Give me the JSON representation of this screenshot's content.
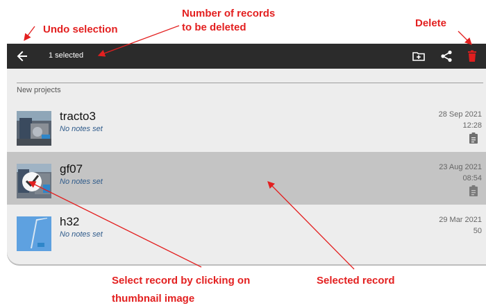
{
  "annotations": {
    "undo_selection": "Undo selection",
    "number_of_records_line1": "Number of records",
    "number_of_records_line2": "to be deleted",
    "delete": "Delete",
    "select_record_line1": "Select record by clicking on",
    "select_record_line2": "thumbnail image",
    "selected_record": "Selected record"
  },
  "appbar": {
    "back_icon": "arrow-left-icon",
    "selection_text": "1 selected",
    "actions": [
      {
        "name": "move-to-folder",
        "icon": "folder-plus-icon"
      },
      {
        "name": "share",
        "icon": "share-icon"
      },
      {
        "name": "delete",
        "icon": "trash-icon",
        "color": "#e01e1e"
      }
    ]
  },
  "section_header": "New projects",
  "records": [
    {
      "name": "tracto3",
      "notes": "No notes set",
      "date": "28 Sep 2021",
      "time": "12:28",
      "selected": false
    },
    {
      "name": "gf07",
      "notes": "No notes set",
      "date": "23 Aug 2021",
      "time": "08:54",
      "selected": true
    },
    {
      "name": "h32",
      "notes": "No notes set",
      "date": "29 Mar 2021",
      "time": "50",
      "selected": false
    }
  ],
  "colors": {
    "annotation": "#e32020",
    "appbar": "#2b2b2b",
    "selected_row": "#c4c4c4",
    "fab": "#2196f3",
    "notes": "#2e5a8a"
  }
}
